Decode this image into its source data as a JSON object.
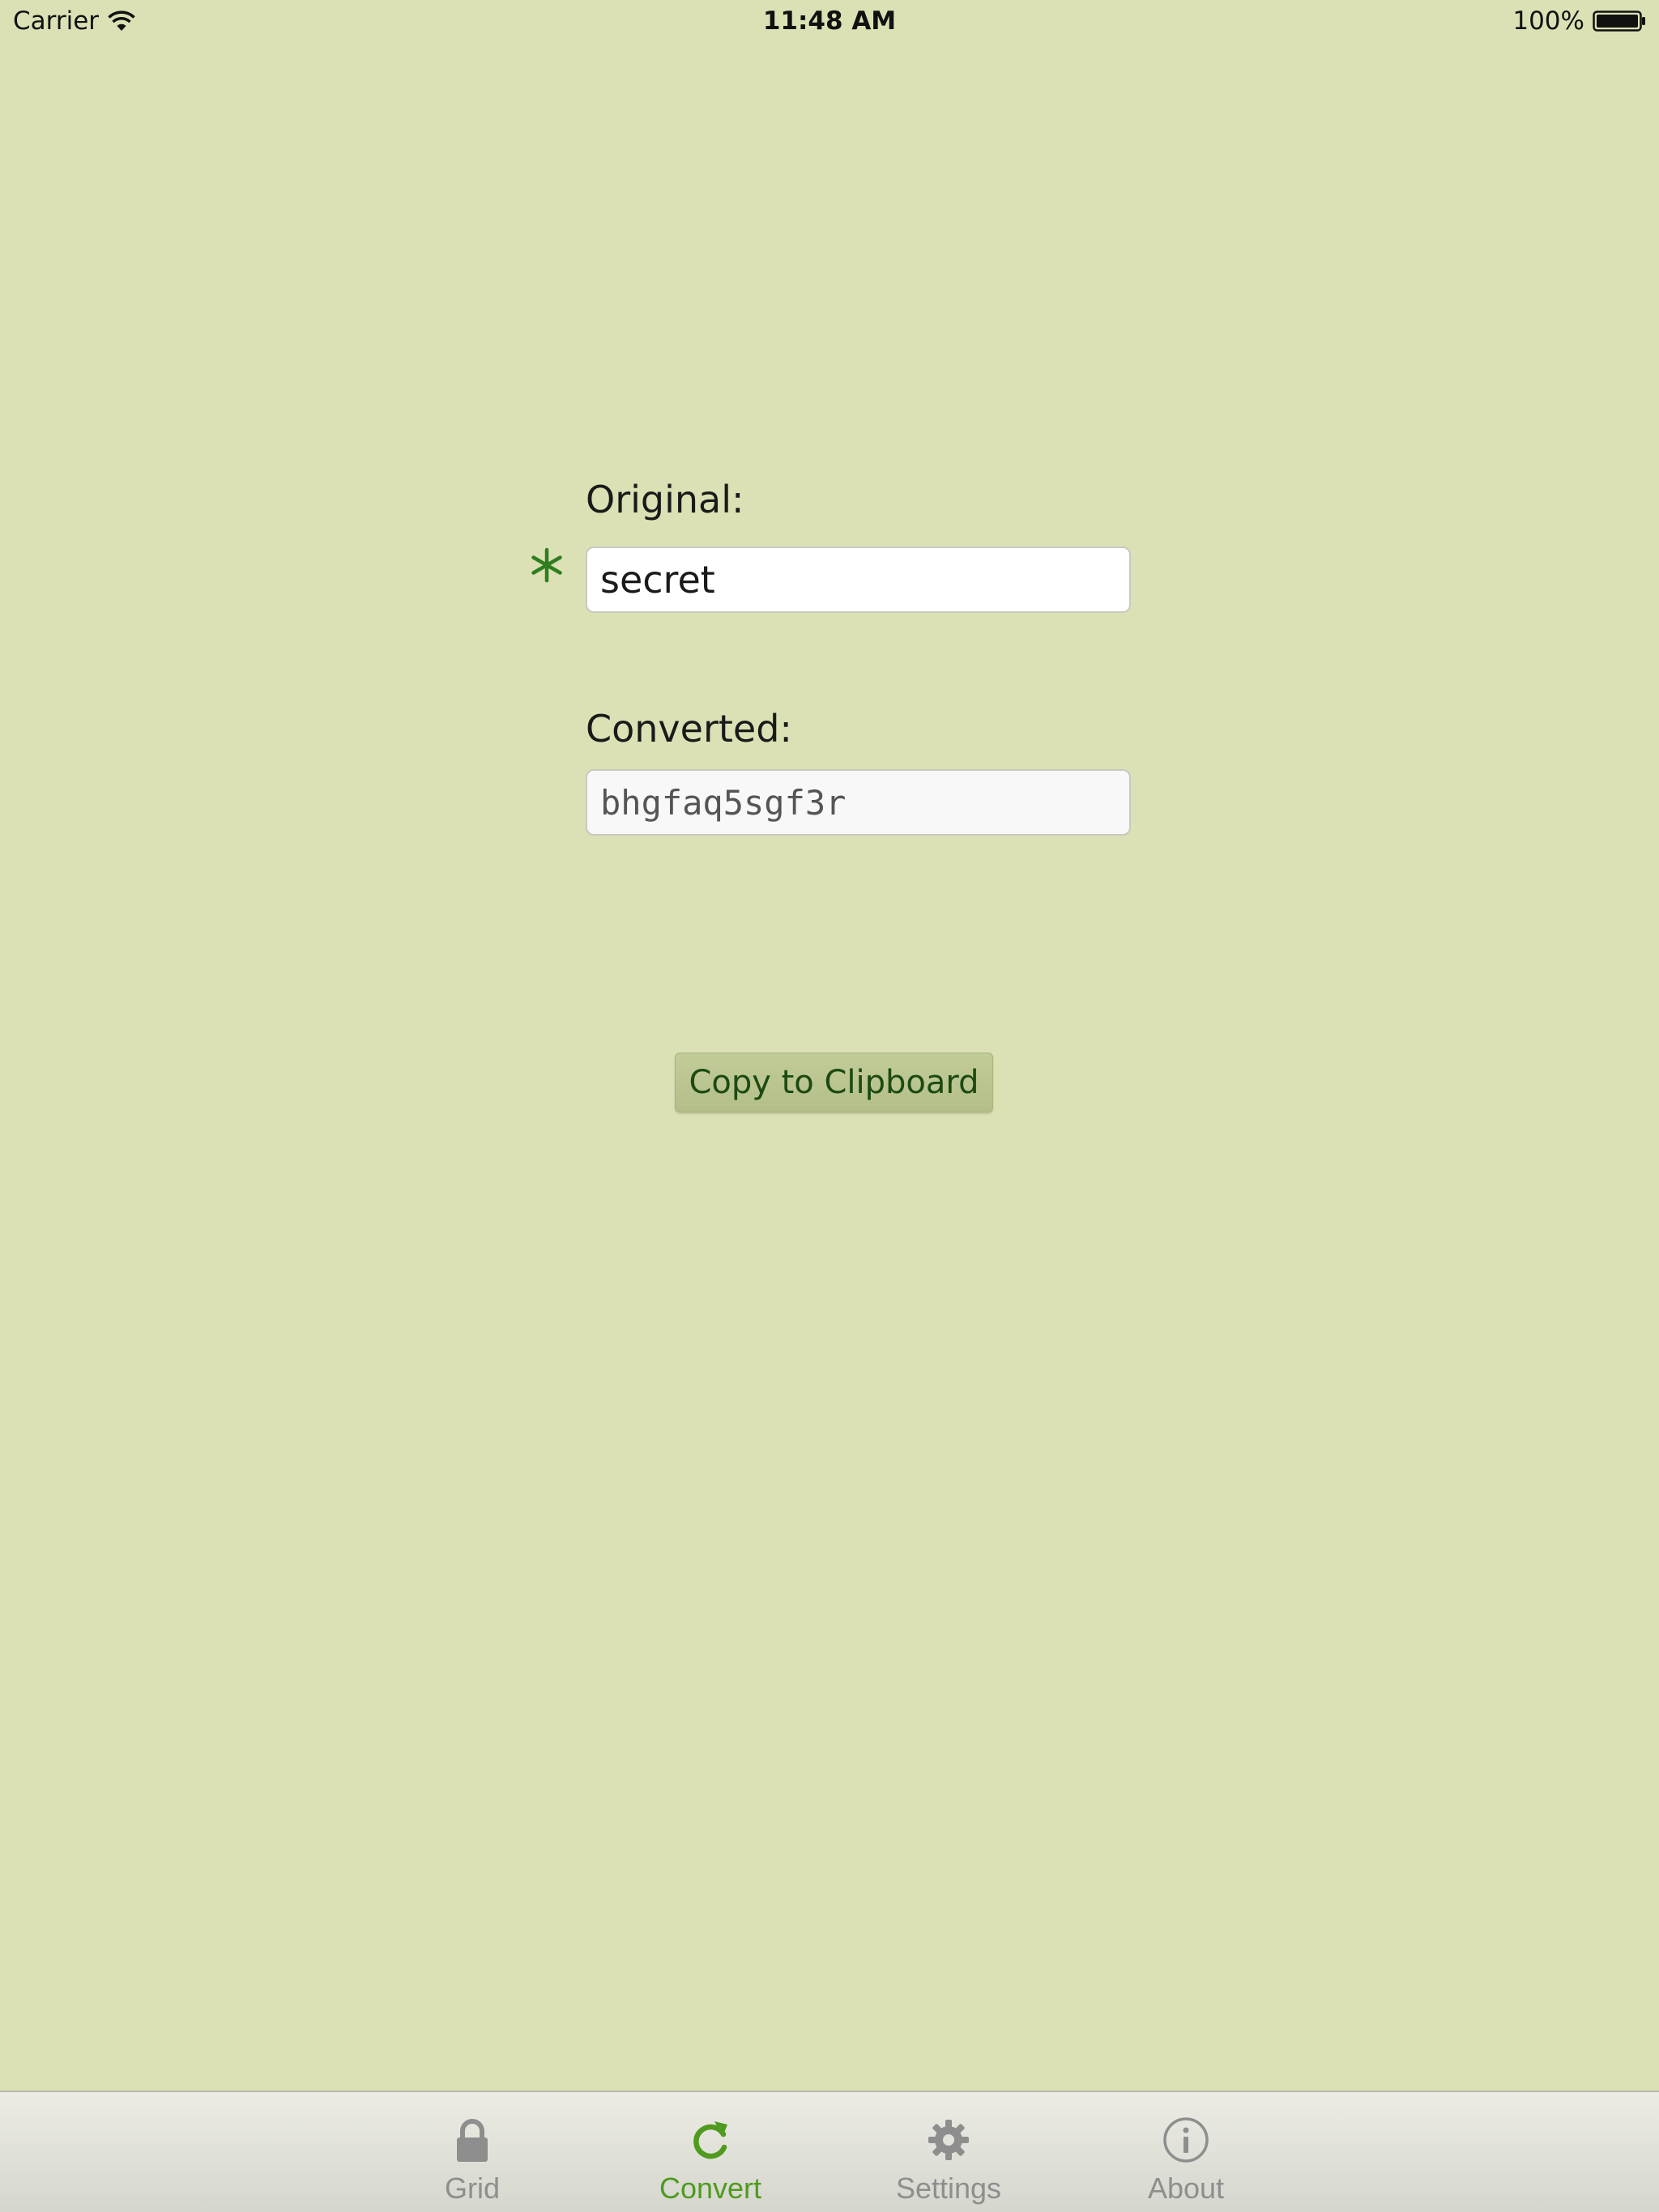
{
  "status_bar": {
    "carrier": "Carrier",
    "time": "11:48 AM",
    "battery": "100%",
    "icons": [
      "wifi-icon",
      "battery-icon"
    ]
  },
  "form": {
    "original_label": "Original:",
    "original_value": "secret",
    "marker_icon": "asterisk-icon",
    "converted_label": "Converted:",
    "converted_value": "bhgfaq5sgf3r",
    "copy_button": "Copy to Clipboard"
  },
  "tab_bar": {
    "active": "Convert",
    "items": [
      {
        "label": "Grid",
        "icon": "lock-icon"
      },
      {
        "label": "Convert",
        "icon": "refresh-icon"
      },
      {
        "label": "Settings",
        "icon": "gear-icon"
      },
      {
        "label": "About",
        "icon": "info-icon"
      }
    ]
  },
  "colors": {
    "background": "#dbe1b4",
    "accent": "#4f9a1f",
    "asterisk": "#2e7d1f",
    "button_text": "#1c4a12",
    "inactive_tab": "#8e8e8e"
  }
}
